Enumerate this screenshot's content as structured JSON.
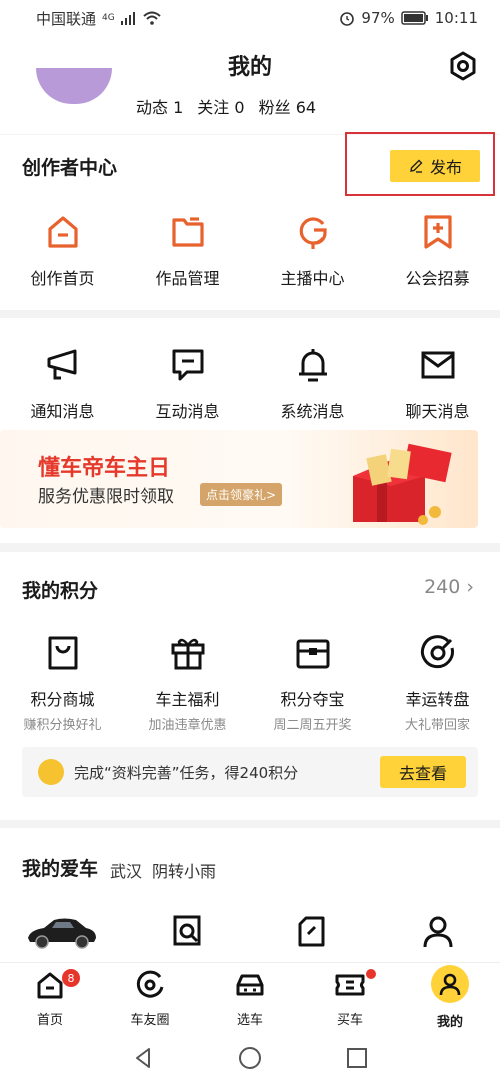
{
  "status": {
    "carrier": "中国联通",
    "network": "4G",
    "battery": "97%",
    "time": "10:11"
  },
  "header": {
    "title": "我的"
  },
  "profile": {
    "stats": [
      {
        "label": "动态",
        "value": "1"
      },
      {
        "label": "关注",
        "value": "0"
      },
      {
        "label": "粉丝",
        "value": "64"
      }
    ]
  },
  "creator": {
    "title": "创作者中心",
    "publish_label": "发布",
    "items": [
      {
        "label": "创作首页",
        "icon": "creator-home-icon"
      },
      {
        "label": "作品管理",
        "icon": "folder-icon"
      },
      {
        "label": "主播中心",
        "icon": "microphone-icon"
      },
      {
        "label": "公会招募",
        "icon": "guild-bookmark-icon"
      }
    ]
  },
  "messages": {
    "items": [
      {
        "label": "通知消息",
        "icon": "megaphone-icon"
      },
      {
        "label": "互动消息",
        "icon": "chat-icon"
      },
      {
        "label": "系统消息",
        "icon": "bell-icon"
      },
      {
        "label": "聊天消息",
        "icon": "mail-icon"
      }
    ]
  },
  "banner": {
    "title": "懂车帝车主日",
    "subtitle": "服务优惠限时领取",
    "cta": "点击领豪礼>"
  },
  "points": {
    "title": "我的积分",
    "count": "240",
    "items": [
      {
        "label": "积分商城",
        "sub": "赚积分换好礼",
        "icon": "shopping-bag-icon"
      },
      {
        "label": "车主福利",
        "sub": "加油违章优惠",
        "icon": "gift-icon"
      },
      {
        "label": "积分夺宝",
        "sub": "周二周五开奖",
        "icon": "treasure-box-icon"
      },
      {
        "label": "幸运转盘",
        "sub": "大礼带回家",
        "icon": "wheel-icon"
      }
    ],
    "task_text": "完成“资料完善”任务，得240积分",
    "task_button": "去查看"
  },
  "car": {
    "title": "我的爱车",
    "city": "武汉",
    "weather": "阴转小雨"
  },
  "tabs": [
    {
      "label": "首页",
      "icon": "home-icon",
      "badge": "8"
    },
    {
      "label": "车友圈",
      "icon": "circle-icon"
    },
    {
      "label": "选车",
      "icon": "car-icon"
    },
    {
      "label": "买车",
      "icon": "ticket-icon"
    },
    {
      "label": "我的",
      "icon": "user-icon"
    }
  ],
  "colors": {
    "accent": "#ffd23a",
    "creator_icon": "#e8622d",
    "badge": "#e6352b",
    "banner_red": "#e4392b"
  }
}
